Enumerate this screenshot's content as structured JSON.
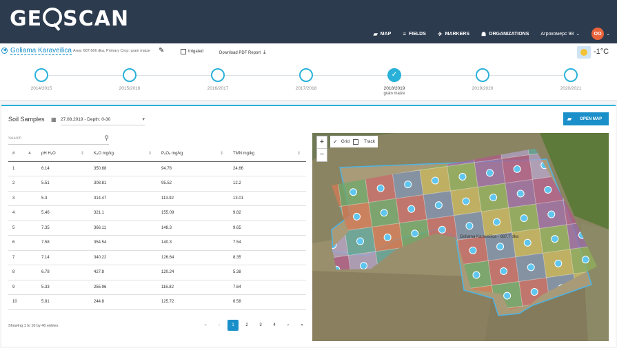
{
  "app": {
    "logo": "GEOSCAN"
  },
  "nav": {
    "items": [
      {
        "label": "MAP",
        "icon": "map-icon",
        "glyph": "▰"
      },
      {
        "label": "FIELDS",
        "icon": "list-icon",
        "glyph": "≡"
      },
      {
        "label": "MARKERS",
        "icon": "marker-icon",
        "glyph": "✈"
      },
      {
        "label": "ORGANIZATIONS",
        "icon": "org-icon",
        "glyph": "☗"
      }
    ],
    "organization": "Агрокомерс 98",
    "avatar_initials": "OO"
  },
  "field": {
    "name": "Goliama Karaveilica",
    "info": "Area: 687.666 dka, Primary Crop: grain maize",
    "irrigated_label": "Irrigated",
    "download_label": "Download PDF Report",
    "temperature": "-1°C"
  },
  "timeline": [
    {
      "year": "2014/2015",
      "crop": "",
      "active": false
    },
    {
      "year": "2015/2016",
      "crop": "",
      "active": false
    },
    {
      "year": "2016/2017",
      "crop": "",
      "active": false
    },
    {
      "year": "2017/2018",
      "crop": "",
      "active": false
    },
    {
      "year": "2018/2019",
      "crop": "grain maize",
      "active": true
    },
    {
      "year": "2019/2020",
      "crop": "",
      "active": false
    },
    {
      "year": "2020/2021",
      "crop": "",
      "active": false
    }
  ],
  "soil": {
    "title": "Soil Samples",
    "date_select": "27.08.2019 - Depth: 0-30",
    "open_map_label": "OPEN MAP",
    "search_placeholder": "Search",
    "columns": [
      "#",
      "pH H₂O",
      "K₂O mg/kg",
      "P₂O₅ mg/kg",
      "TMN mg/kg"
    ],
    "rows": [
      [
        "1",
        "6.14",
        "350.88",
        "94.78",
        "24.66"
      ],
      [
        "2",
        "5.51",
        "308.81",
        "95.52",
        "12.2"
      ],
      [
        "3",
        "5.3",
        "314.47",
        "113.92",
        "13.01"
      ],
      [
        "4",
        "5.46",
        "321.1",
        "155.09",
        "9.82"
      ],
      [
        "5",
        "7.35",
        "366.11",
        "148.3",
        "9.65"
      ],
      [
        "6",
        "7.58",
        "354.54",
        "140.3",
        "7.54"
      ],
      [
        "7",
        "7.14",
        "340.22",
        "126.64",
        "8.35"
      ],
      [
        "8",
        "6.78",
        "427.8",
        "120.24",
        "5.38"
      ],
      [
        "9",
        "5.33",
        "255.96",
        "116.82",
        "7.64"
      ],
      [
        "10",
        "5.81",
        "244.8",
        "125.72",
        "6.58"
      ]
    ],
    "showing": "Showing 1 to 10 by 40 entries",
    "pagination": [
      "«",
      "‹",
      "1",
      "2",
      "3",
      "4",
      "›",
      "»"
    ],
    "current_page": "1"
  },
  "map": {
    "zoom_in": "+",
    "zoom_out": "−",
    "grid_label": "Grid",
    "track_label": "Track",
    "field_label": "Goliama Karaveilica - 687.7 dka"
  }
}
